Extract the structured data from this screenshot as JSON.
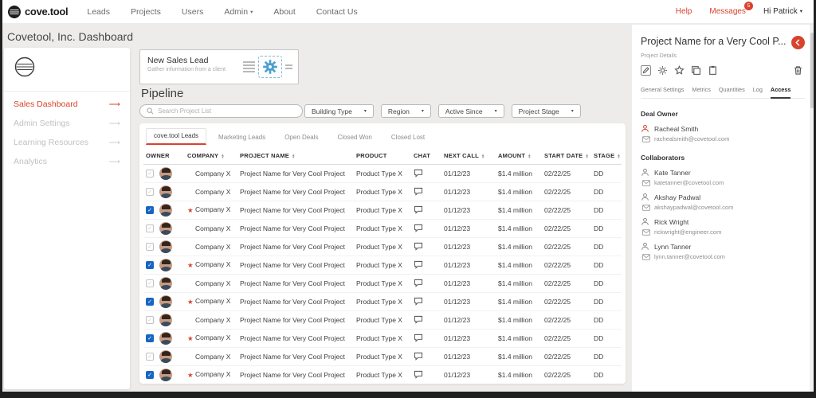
{
  "topnav": {
    "brand": "cove.tool",
    "links": [
      {
        "label": "Leads",
        "caret": false
      },
      {
        "label": "Projects",
        "caret": false
      },
      {
        "label": "Users",
        "caret": false
      },
      {
        "label": "Admin",
        "caret": true
      },
      {
        "label": "About",
        "caret": false
      },
      {
        "label": "Contact Us",
        "caret": false
      }
    ],
    "help": "Help",
    "messages": "Messages",
    "messages_badge": "5",
    "user": "Hi Patrick"
  },
  "page_title": "Covetool, Inc. Dashboard",
  "sidebar": {
    "items": [
      {
        "label": "Sales Dashboard",
        "active": true
      },
      {
        "label": "Admin Settings",
        "active": false
      },
      {
        "label": "Learning Resources",
        "active": false
      },
      {
        "label": "Analytics",
        "active": false
      }
    ]
  },
  "main": {
    "new_lead_card": {
      "title": "New Sales Lead",
      "subtitle": "Gather information from a client"
    },
    "pipeline_title": "Pipeline",
    "search_placeholder": "Search Project List",
    "filters": [
      "Building Type",
      "Region",
      "Active Since",
      "Project Stage"
    ],
    "tabs": [
      {
        "label": "cove.tool Leads",
        "active": true
      },
      {
        "label": "Marketing Leads",
        "active": false
      },
      {
        "label": "Open Deals",
        "active": false
      },
      {
        "label": "Closed Won",
        "active": false
      },
      {
        "label": "Closed Lost",
        "active": false
      }
    ],
    "table": {
      "columns": [
        {
          "label": "OWNER",
          "sortable": false
        },
        {
          "label": "COMPANY",
          "sortable": true
        },
        {
          "label": "PROJECT NAME",
          "sortable": true
        },
        {
          "label": "PRODUCT",
          "sortable": false
        },
        {
          "label": "CHAT",
          "sortable": false
        },
        {
          "label": "NEXT CALL",
          "sortable": true
        },
        {
          "label": "AMOUNT",
          "sortable": true
        },
        {
          "label": "START DATE",
          "sortable": true
        },
        {
          "label": "STAGE",
          "sortable": true
        }
      ],
      "rows": [
        {
          "checked": false,
          "starred": false,
          "company": "Company X",
          "project": "Project Name for Very Cool Project",
          "product": "Product Type X",
          "next_call": "01/12/23",
          "amount": "$1.4 million",
          "start_date": "02/22/25",
          "stage": "DD"
        },
        {
          "checked": false,
          "starred": false,
          "company": "Company X",
          "project": "Project Name for Very Cool Project",
          "product": "Product Type X",
          "next_call": "01/12/23",
          "amount": "$1.4 million",
          "start_date": "02/22/25",
          "stage": "DD"
        },
        {
          "checked": true,
          "starred": true,
          "company": "Company X",
          "project": "Project Name for Very Cool Project",
          "product": "Product Type X",
          "next_call": "01/12/23",
          "amount": "$1.4 million",
          "start_date": "02/22/25",
          "stage": "DD"
        },
        {
          "checked": false,
          "starred": false,
          "company": "Company X",
          "project": "Project Name for Very Cool Project",
          "product": "Product Type X",
          "next_call": "01/12/23",
          "amount": "$1.4 million",
          "start_date": "02/22/25",
          "stage": "DD"
        },
        {
          "checked": false,
          "starred": false,
          "company": "Company X",
          "project": "Project Name for Very Cool Project",
          "product": "Product Type X",
          "next_call": "01/12/23",
          "amount": "$1.4 million",
          "start_date": "02/22/25",
          "stage": "DD"
        },
        {
          "checked": true,
          "starred": true,
          "company": "Company X",
          "project": "Project Name for Very Cool Project",
          "product": "Product Type X",
          "next_call": "01/12/23",
          "amount": "$1.4 million",
          "start_date": "02/22/25",
          "stage": "DD"
        },
        {
          "checked": false,
          "starred": false,
          "company": "Company X",
          "project": "Project Name for Very Cool Project",
          "product": "Product Type X",
          "next_call": "01/12/23",
          "amount": "$1.4 million",
          "start_date": "02/22/25",
          "stage": "DD"
        },
        {
          "checked": true,
          "starred": true,
          "company": "Company X",
          "project": "Project Name for Very Cool Project",
          "product": "Product Type X",
          "next_call": "01/12/23",
          "amount": "$1.4 million",
          "start_date": "02/22/25",
          "stage": "DD"
        },
        {
          "checked": false,
          "starred": false,
          "company": "Company X",
          "project": "Project Name for Very Cool Project",
          "product": "Product Type X",
          "next_call": "01/12/23",
          "amount": "$1.4 million",
          "start_date": "02/22/25",
          "stage": "DD"
        },
        {
          "checked": true,
          "starred": true,
          "company": "Company X",
          "project": "Project Name for Very Cool Project",
          "product": "Product Type X",
          "next_call": "01/12/23",
          "amount": "$1.4 million",
          "start_date": "02/22/25",
          "stage": "DD"
        },
        {
          "checked": false,
          "starred": false,
          "company": "Company X",
          "project": "Project Name for Very Cool Project",
          "product": "Product Type X",
          "next_call": "01/12/23",
          "amount": "$1.4 million",
          "start_date": "02/22/25",
          "stage": "DD"
        },
        {
          "checked": true,
          "starred": true,
          "company": "Company X",
          "project": "Project Name for Very Cool Project",
          "product": "Product Type X",
          "next_call": "01/12/23",
          "amount": "$1.4 million",
          "start_date": "02/22/25",
          "stage": "DD"
        }
      ]
    }
  },
  "right_panel": {
    "title": "Project Name for a Very Cool P...",
    "subtitle": "Project Details",
    "tabs": [
      "General Settings",
      "Metrics",
      "Quantities",
      "Log",
      "Access"
    ],
    "active_tab": "Access",
    "deal_owner_label": "Deal Owner",
    "deal_owner": {
      "name": "Racheal Smith",
      "email": "rachealsmith@covetool.com"
    },
    "collaborators_label": "Collaborators",
    "collaborators": [
      {
        "name": "Kate Tanner",
        "email": "katetanner@covetool.com"
      },
      {
        "name": "Akshay Padwal",
        "email": "akshaypadwal@covetool.com"
      },
      {
        "name": "Rick Wright",
        "email": "rickwright@engineer.com"
      },
      {
        "name": "Lynn Tanner",
        "email": "lynn.tanner@covetool.com"
      }
    ]
  },
  "colors": {
    "accent_red": "#d8432e",
    "check_blue": "#1766c2",
    "gear_blue": "#4aa0cf"
  }
}
